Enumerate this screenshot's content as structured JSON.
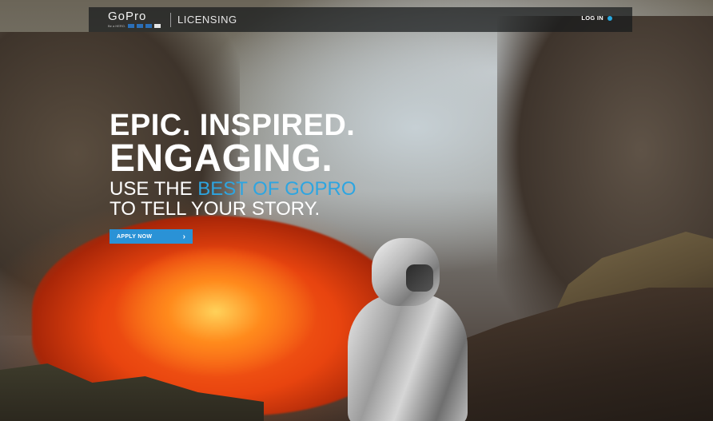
{
  "header": {
    "logo_text": "GoPro",
    "logo_tagline": "Be a HERO.",
    "logo_squares": [
      "#2b6fb8",
      "#2b6fb8",
      "#2b6fb8",
      "#e6e6e6"
    ],
    "section_title": "LICENSING",
    "login_label": "LOG IN"
  },
  "hero": {
    "line1": "EPIC. INSPIRED.",
    "line2": "ENGAGING.",
    "line3_prefix": "USE THE ",
    "line3_accent": "BEST OF GOPRO",
    "line4": "TO TELL YOUR STORY."
  },
  "cta": {
    "label": "APPLY NOW",
    "chevron": "›"
  },
  "colors": {
    "accent": "#2da5e1",
    "button": "#2a92d6",
    "topbar": "#181a1c"
  }
}
